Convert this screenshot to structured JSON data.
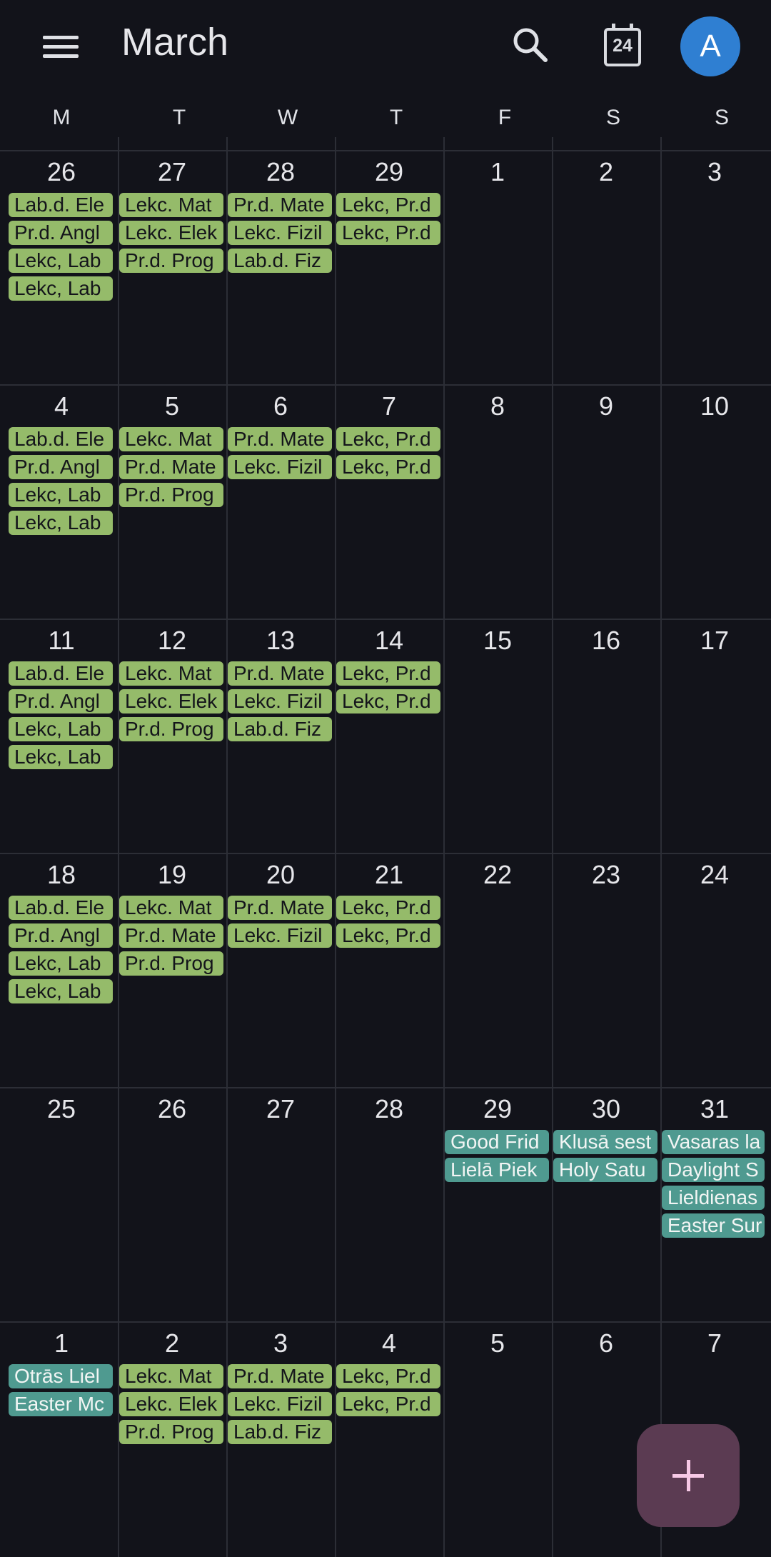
{
  "header": {
    "title": "March",
    "today_number": "24",
    "avatar_letter": "A"
  },
  "weekdays": [
    "M",
    "T",
    "W",
    "T",
    "F",
    "S",
    "S"
  ],
  "weeks": [
    {
      "days": [
        {
          "num": "26",
          "events": [
            {
              "text": "Lab.d. Ele",
              "kind": "green"
            },
            {
              "text": "Pr.d. Angl",
              "kind": "green"
            },
            {
              "text": "Lekc, Lab",
              "kind": "green"
            },
            {
              "text": "Lekc, Lab",
              "kind": "green"
            }
          ]
        },
        {
          "num": "27",
          "events": [
            {
              "text": "Lekc. Mat",
              "kind": "green"
            },
            {
              "text": "Lekc. Elek",
              "kind": "green"
            },
            {
              "text": "Pr.d. Prog",
              "kind": "green"
            }
          ]
        },
        {
          "num": "28",
          "events": [
            {
              "text": "Pr.d. Mate",
              "kind": "green"
            },
            {
              "text": "Lekc. Fizil",
              "kind": "green"
            },
            {
              "text": "Lab.d. Fiz",
              "kind": "green"
            }
          ]
        },
        {
          "num": "29",
          "events": [
            {
              "text": "Lekc, Pr.d",
              "kind": "green"
            },
            {
              "text": "Lekc, Pr.d",
              "kind": "green"
            }
          ]
        },
        {
          "num": "1",
          "events": []
        },
        {
          "num": "2",
          "events": []
        },
        {
          "num": "3",
          "events": []
        }
      ]
    },
    {
      "days": [
        {
          "num": "4",
          "events": [
            {
              "text": "Lab.d. Ele",
              "kind": "green"
            },
            {
              "text": "Pr.d. Angl",
              "kind": "green"
            },
            {
              "text": "Lekc, Lab",
              "kind": "green"
            },
            {
              "text": "Lekc, Lab",
              "kind": "green"
            }
          ]
        },
        {
          "num": "5",
          "events": [
            {
              "text": "Lekc. Mat",
              "kind": "green"
            },
            {
              "text": "Pr.d. Mate",
              "kind": "green"
            },
            {
              "text": "Pr.d. Prog",
              "kind": "green"
            }
          ]
        },
        {
          "num": "6",
          "events": [
            {
              "text": "Pr.d. Mate",
              "kind": "green"
            },
            {
              "text": "Lekc. Fizil",
              "kind": "green"
            }
          ]
        },
        {
          "num": "7",
          "events": [
            {
              "text": "Lekc, Pr.d",
              "kind": "green"
            },
            {
              "text": "Lekc, Pr.d",
              "kind": "green"
            }
          ]
        },
        {
          "num": "8",
          "events": []
        },
        {
          "num": "9",
          "events": []
        },
        {
          "num": "10",
          "events": []
        }
      ]
    },
    {
      "days": [
        {
          "num": "11",
          "events": [
            {
              "text": "Lab.d. Ele",
              "kind": "green"
            },
            {
              "text": "Pr.d. Angl",
              "kind": "green"
            },
            {
              "text": "Lekc, Lab",
              "kind": "green"
            },
            {
              "text": "Lekc, Lab",
              "kind": "green"
            }
          ]
        },
        {
          "num": "12",
          "events": [
            {
              "text": "Lekc. Mat",
              "kind": "green"
            },
            {
              "text": "Lekc. Elek",
              "kind": "green"
            },
            {
              "text": "Pr.d. Prog",
              "kind": "green"
            }
          ]
        },
        {
          "num": "13",
          "events": [
            {
              "text": "Pr.d. Mate",
              "kind": "green"
            },
            {
              "text": "Lekc. Fizil",
              "kind": "green"
            },
            {
              "text": "Lab.d. Fiz",
              "kind": "green"
            }
          ]
        },
        {
          "num": "14",
          "events": [
            {
              "text": "Lekc, Pr.d",
              "kind": "green"
            },
            {
              "text": "Lekc, Pr.d",
              "kind": "green"
            }
          ]
        },
        {
          "num": "15",
          "events": []
        },
        {
          "num": "16",
          "events": []
        },
        {
          "num": "17",
          "events": []
        }
      ]
    },
    {
      "days": [
        {
          "num": "18",
          "events": [
            {
              "text": "Lab.d. Ele",
              "kind": "green"
            },
            {
              "text": "Pr.d. Angl",
              "kind": "green"
            },
            {
              "text": "Lekc, Lab",
              "kind": "green"
            },
            {
              "text": "Lekc, Lab",
              "kind": "green"
            }
          ]
        },
        {
          "num": "19",
          "events": [
            {
              "text": "Lekc. Mat",
              "kind": "green"
            },
            {
              "text": "Pr.d. Mate",
              "kind": "green"
            },
            {
              "text": "Pr.d. Prog",
              "kind": "green"
            }
          ]
        },
        {
          "num": "20",
          "events": [
            {
              "text": "Pr.d. Mate",
              "kind": "green"
            },
            {
              "text": "Lekc. Fizil",
              "kind": "green"
            }
          ]
        },
        {
          "num": "21",
          "events": [
            {
              "text": "Lekc, Pr.d",
              "kind": "green"
            },
            {
              "text": "Lekc, Pr.d",
              "kind": "green"
            }
          ]
        },
        {
          "num": "22",
          "events": []
        },
        {
          "num": "23",
          "events": []
        },
        {
          "num": "24",
          "events": []
        }
      ]
    },
    {
      "days": [
        {
          "num": "25",
          "events": []
        },
        {
          "num": "26",
          "events": []
        },
        {
          "num": "27",
          "events": []
        },
        {
          "num": "28",
          "events": []
        },
        {
          "num": "29",
          "events": [
            {
              "text": "Good Frid",
              "kind": "teal"
            },
            {
              "text": "Lielā Piek",
              "kind": "teal"
            }
          ]
        },
        {
          "num": "30",
          "events": [
            {
              "text": "Klusā sest",
              "kind": "teal"
            },
            {
              "text": "Holy Satu",
              "kind": "teal"
            }
          ]
        },
        {
          "num": "31",
          "events": [
            {
              "text": "Vasaras la",
              "kind": "teal"
            },
            {
              "text": "Daylight S",
              "kind": "teal"
            },
            {
              "text": "Lieldienas",
              "kind": "teal"
            },
            {
              "text": "Easter Sur",
              "kind": "teal"
            }
          ]
        }
      ]
    },
    {
      "days": [
        {
          "num": "1",
          "events": [
            {
              "text": "Otrās Liel",
              "kind": "teal"
            },
            {
              "text": "Easter Mc",
              "kind": "teal"
            }
          ]
        },
        {
          "num": "2",
          "events": [
            {
              "text": "Lekc. Mat",
              "kind": "green"
            },
            {
              "text": "Lekc. Elek",
              "kind": "green"
            },
            {
              "text": "Pr.d. Prog",
              "kind": "green"
            }
          ]
        },
        {
          "num": "3",
          "events": [
            {
              "text": "Pr.d. Mate",
              "kind": "green"
            },
            {
              "text": "Lekc. Fizil",
              "kind": "green"
            },
            {
              "text": "Lab.d. Fiz",
              "kind": "green"
            }
          ]
        },
        {
          "num": "4",
          "events": [
            {
              "text": "Lekc, Pr.d",
              "kind": "green"
            },
            {
              "text": "Lekc, Pr.d",
              "kind": "green"
            }
          ]
        },
        {
          "num": "5",
          "events": []
        },
        {
          "num": "6",
          "events": []
        },
        {
          "num": "7",
          "events": []
        }
      ]
    }
  ],
  "colors": {
    "background": "#12131a",
    "event_class": "#95bb6a",
    "event_holiday": "#4f9a90",
    "fab": "#5b3b52",
    "avatar": "#2f7fd2"
  },
  "icons": {
    "menu": "menu-icon",
    "search": "search-icon",
    "today": "calendar-today-icon",
    "fab": "plus-icon"
  }
}
